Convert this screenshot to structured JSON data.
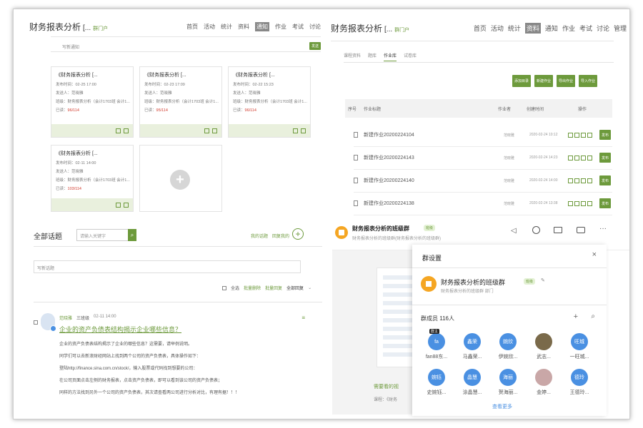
{
  "left_panel": {
    "title": "财务报表分析",
    "crumb_prefix": "[...",
    "crumb": "群门户",
    "nav": [
      "首页",
      "活动",
      "统计",
      "资料",
      "通知",
      "作业",
      "考试",
      "讨论"
    ],
    "nav_active_index": 4,
    "notice_placeholder": "写新通知",
    "notice_button": "发送",
    "cards": [
      {
        "title": "《财务报表分析 [...",
        "time": "发布时间：02-25 17:00",
        "sender": "发送人：范晓雅",
        "class": "班级：财务报表分析（会计1703班 会计1...",
        "read_label": "已读：",
        "read_value": "96/114"
      },
      {
        "title": "《财务报表分析 [...",
        "time": "发布时间：02-23 17:09",
        "sender": "发送人：范晓雅",
        "class": "班级：财务报表分析（会计1703班 会计1...",
        "read_label": "已读：",
        "read_value": "95/114"
      },
      {
        "title": "《财务报表分析 [...",
        "time": "发布时间：02-22 15:23",
        "sender": "发送人：范晓雅",
        "class": "班级：财务报表分析（会计1703班 会计1...",
        "read_label": "已读：",
        "read_value": "96/114"
      },
      {
        "title": "《财务报表分析 [...",
        "time": "发布时间：02-11 14:00",
        "sender": "发送人：范晓雅",
        "class": "班级：财务报表分析（会计1703班 会计1...",
        "read_label": "已读：",
        "read_value": "103/114"
      }
    ],
    "topics": {
      "heading": "全部话题",
      "search_placeholder": "请输入关键字",
      "my_topics": "我的话题",
      "reply_me": "回复我的",
      "new_topic_placeholder": "写新话题",
      "toolbar": [
        "全选",
        "批量删除",
        "批量回复",
        "全部回复"
      ],
      "post": {
        "author": "范晓雅",
        "class_label": "三班级",
        "date": "02-11 14:00",
        "title": "企业的资产负债表结构揭示企业哪些信息？",
        "lines": [
          "企业的资产负债表结构揭示了企业的哪些信息？这需要，请举例说明。",
          "同学们可以去新浪财经网站上找到两个公司的资产负债表，具体操作如下：",
          "登陆http://finance.sina.com.cn/stock/，输入股票或代码找到想要的公司：",
          "在公司页面点击左侧的财务报表，点击资产负债表，即可以看到该公司的资产负债表；",
          "同样的方法找到另外一个公司的资产负债表，其次请查看两公司进行分析对比，有理有据！！！"
        ]
      }
    }
  },
  "right_panel": {
    "title": "财务报表分析",
    "crumb_prefix": "[...",
    "crumb": "群门户",
    "nav": [
      "首页",
      "活动",
      "统计",
      "资料",
      "通知",
      "作业",
      "考试",
      "讨论",
      "管理"
    ],
    "nav_active_index": 3,
    "subtabs": [
      "课程资料",
      "题库",
      "作业库",
      "试卷库"
    ],
    "subtab_active_index": 2,
    "actions": [
      "添加目录",
      "新建作业",
      "导出作业",
      "导入作业"
    ],
    "table_headers": [
      "序号",
      "作业标题",
      "作业者",
      "创建时间",
      "操作"
    ],
    "rows": [
      {
        "title": "新建作业20200224104",
        "author": "范晓雅",
        "time": "2020-02-24 10:12",
        "btn": "发布"
      },
      {
        "title": "新建作业20200224143",
        "author": "范晓雅",
        "time": "2020-02-24 14:23",
        "btn": "发布"
      },
      {
        "title": "新建作业20200224140",
        "author": "范晓雅",
        "time": "2020-02-24 14:00",
        "btn": "发布"
      },
      {
        "title": "新建作业20200224138",
        "author": "范晓雅",
        "time": "2020-02-24 13:38",
        "btn": "发布"
      }
    ]
  },
  "chat": {
    "group_name": "财务报表分析的班级群",
    "badge": "班级",
    "subtitle": "财务报表分析的班级群(财务报表分析的班级群)",
    "side_label": "需要看的视",
    "side_label2": "课程：《财务",
    "settings": {
      "title": "群设置",
      "group_name": "财务报表分析的班级群",
      "badge": "班级",
      "subtitle": "财务报表分析的班级群  部门",
      "members_label": "群成员 116人",
      "more": "查看更多",
      "members": [
        {
          "initials": "fa",
          "name": "fan88东...",
          "tag": "群主",
          "color": "#4a90e2"
        },
        {
          "initials": "鑫荣",
          "name": "马鑫荣...",
          "tag": "",
          "color": "#4a90e2"
        },
        {
          "initials": "婉欣",
          "name": "伊婉欣...",
          "tag": "",
          "color": "#4a90e2"
        },
        {
          "initials": "",
          "name": "武志...",
          "tag": "",
          "color": "#7a6a4a"
        },
        {
          "initials": "旺城",
          "name": "一旺城...",
          "tag": "",
          "color": "#4a90e2"
        },
        {
          "initials": "婉钰",
          "name": "史婉钰...",
          "tag": "",
          "color": "#4a90e2"
        },
        {
          "initials": "晶慧",
          "name": "涂晶慧...",
          "tag": "",
          "color": "#4a90e2"
        },
        {
          "initials": "海丽",
          "name": "贺海丽...",
          "tag": "",
          "color": "#4a90e2"
        },
        {
          "initials": "",
          "name": "金婷...",
          "tag": "",
          "color": "#c9a7a7"
        },
        {
          "initials": "德玲",
          "name": "王德玲...",
          "tag": "",
          "color": "#4a90e2"
        }
      ]
    }
  },
  "colors": {
    "accent": "#6d9a3c",
    "red": "#d23b2d",
    "blue": "#4a90e2"
  }
}
